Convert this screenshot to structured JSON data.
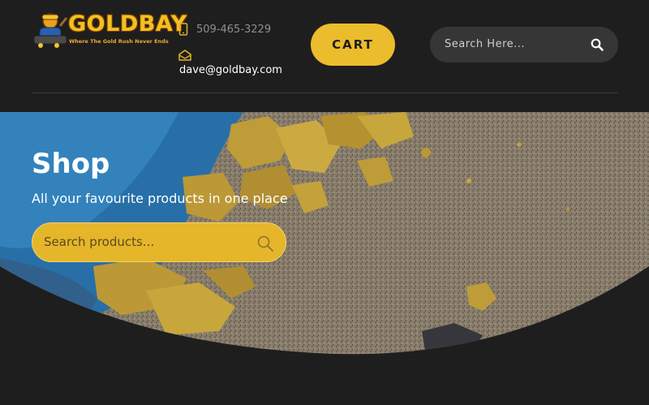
{
  "brand": {
    "name": "GOLDBAY",
    "tagline": "Where The Gold Rush Never Ends"
  },
  "contact": {
    "phone": "509-465-3229",
    "email": "dave@goldbay.com"
  },
  "header": {
    "cart_label": "CART",
    "search_placeholder": "Search Here..."
  },
  "hero": {
    "title": "Shop",
    "subtitle": "All your favourite products in one place",
    "search_placeholder": "Search products..."
  },
  "colors": {
    "background": "#1e1e1e",
    "accent": "#ebbc2b",
    "search_bg": "#363636"
  }
}
